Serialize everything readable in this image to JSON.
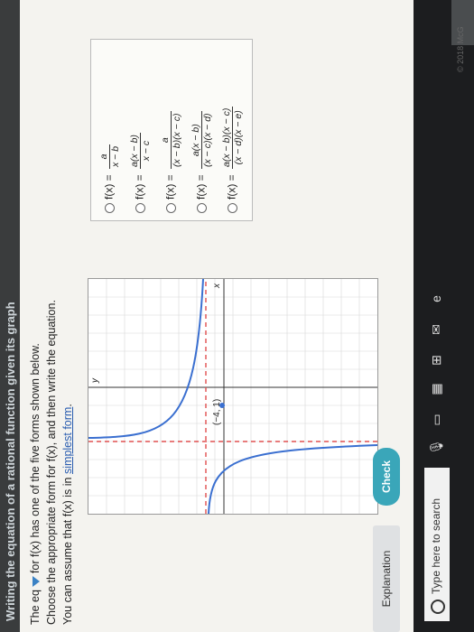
{
  "header": {
    "title": "Writing the equation of a rational function given its graph"
  },
  "problem": {
    "line1_prefix": "The eq",
    "line1_suffix": "for f(x) has one of the five forms shown below.",
    "line2": "Choose the appropriate form for f(x), and then write the equation.",
    "line3_prefix": "You can assume that f(x) is in",
    "line3_link": "simplest form",
    "line3_end": "."
  },
  "graph": {
    "point_label": "(−4, 1)",
    "x_label": "x",
    "y_label": "y"
  },
  "options": [
    {
      "lhs": "f(x) =",
      "num": "a",
      "den": "x − b"
    },
    {
      "lhs": "f(x) =",
      "num": "a(x − b)",
      "den": "x − c"
    },
    {
      "lhs": "f(x) =",
      "num": "a",
      "den": "(x − b)(x − c)"
    },
    {
      "lhs": "f(x) =",
      "num": "a(x − b)",
      "den": "(x − c)(x − d)"
    },
    {
      "lhs": "f(x) =",
      "num": "a(x − b)(x − c)",
      "den": "(x − d)(x − e)"
    }
  ],
  "buttons": {
    "explanation": "Explanation",
    "check": "Check"
  },
  "footer": {
    "copyright": "© 2018 McG"
  },
  "taskbar": {
    "search_placeholder": "Type here to search"
  }
}
